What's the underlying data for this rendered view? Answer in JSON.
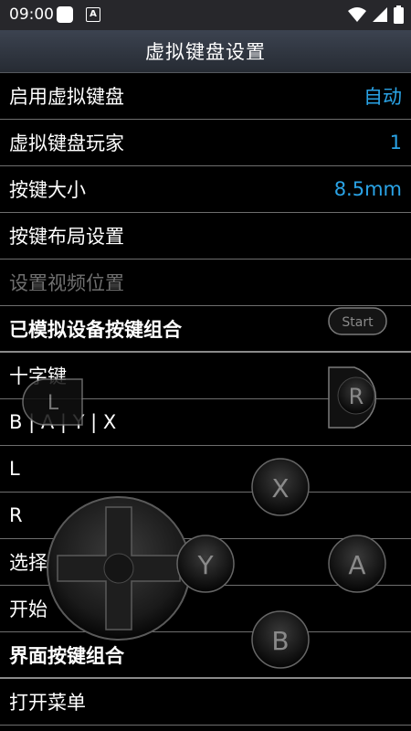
{
  "status_bar": {
    "time": "09:00",
    "notification_badge": "A",
    "icons": [
      "wifi-icon",
      "signal-icon",
      "battery-icon"
    ]
  },
  "app_bar": {
    "title": "虚拟键盘设置"
  },
  "settings": [
    {
      "label": "启用虚拟键盘",
      "value": "自动",
      "type": "item"
    },
    {
      "label": "虚拟键盘玩家",
      "value": "1",
      "type": "item"
    },
    {
      "label": "按键大小",
      "value": "8.5mm",
      "type": "item"
    },
    {
      "label": "按键布局设置",
      "value": "",
      "type": "item"
    },
    {
      "label": "设置视频位置",
      "value": "",
      "type": "disabled"
    },
    {
      "label": "已模拟设备按键组合",
      "value": "",
      "type": "header"
    },
    {
      "label": "十字键",
      "value": "",
      "type": "item"
    },
    {
      "label": "B | A | Y | X",
      "value": "",
      "type": "item"
    },
    {
      "label": "L",
      "value": "",
      "type": "item"
    },
    {
      "label": "R",
      "value": "",
      "type": "item"
    },
    {
      "label": "选择",
      "value": "",
      "type": "item"
    },
    {
      "label": "开始",
      "value": "",
      "type": "item"
    },
    {
      "label": "界面按键组合",
      "value": "",
      "type": "header"
    },
    {
      "label": "打开菜单",
      "value": "",
      "type": "item"
    }
  ],
  "gamepad_overlay": {
    "start_label": "Start",
    "l_label": "L",
    "r_label": "R",
    "x_label": "X",
    "y_label": "Y",
    "a_label": "A",
    "b_label": "B"
  },
  "colors": {
    "accent": "#2aa3e6",
    "divider": "#6e6e6e",
    "app_bar": "#333a45"
  }
}
